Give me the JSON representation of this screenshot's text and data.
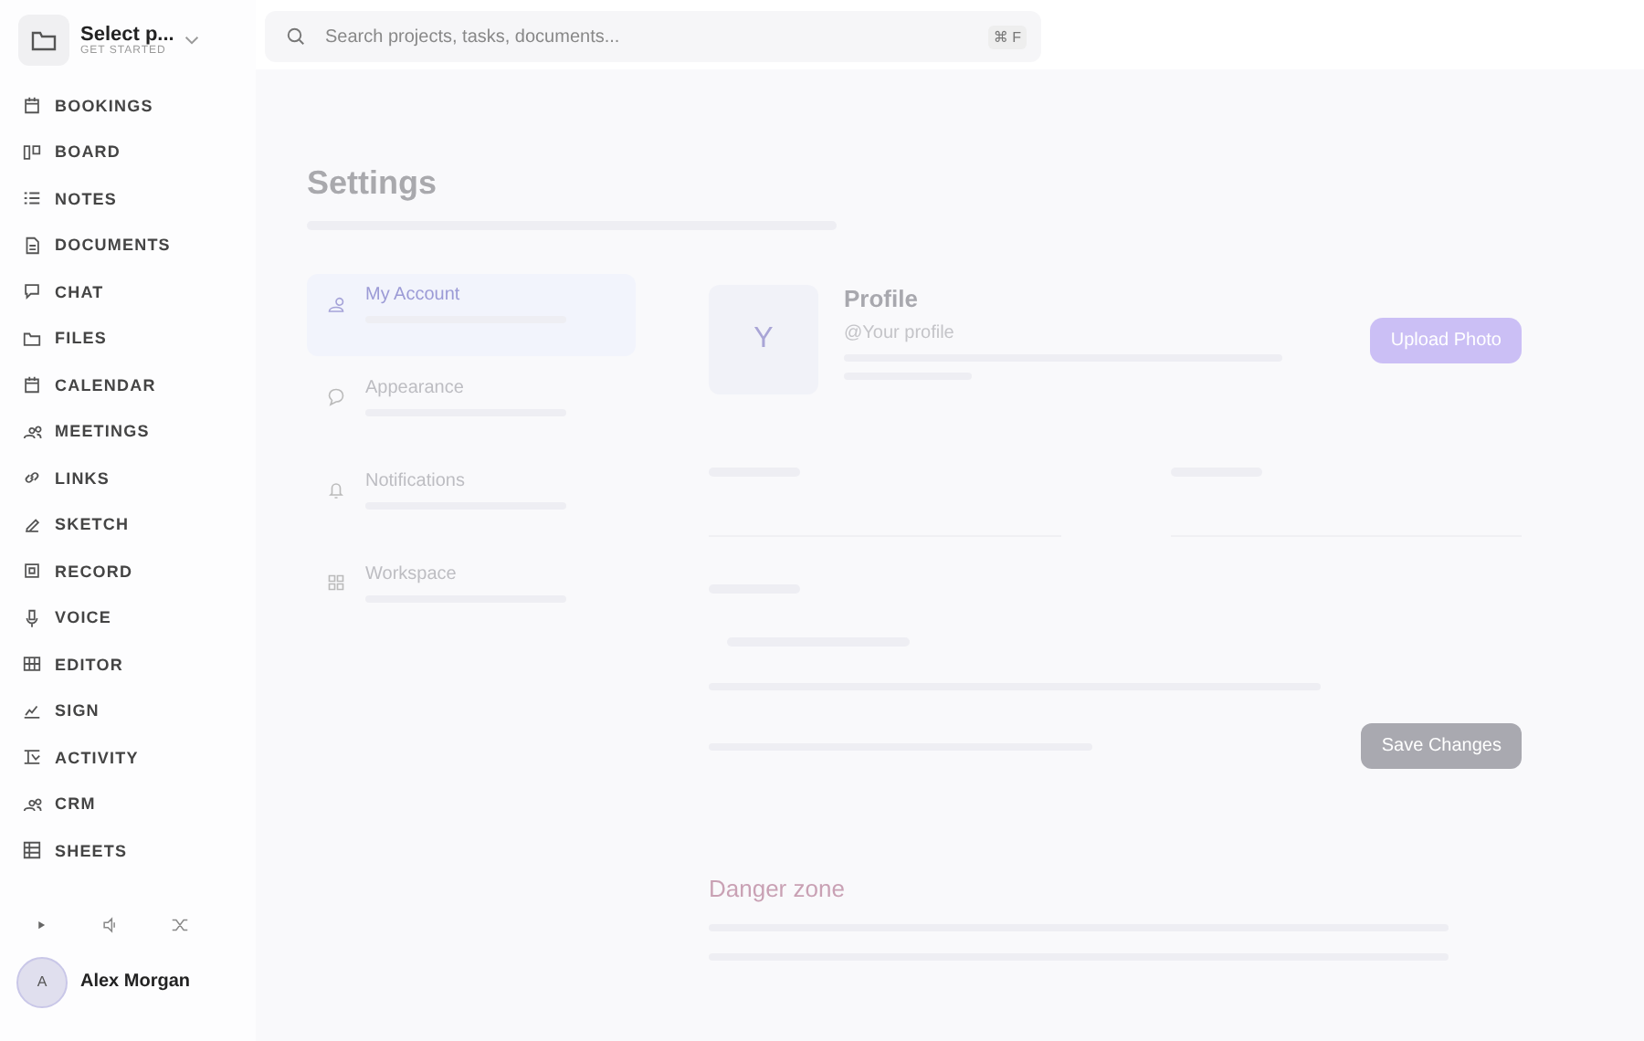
{
  "project_switcher": {
    "title": "Select p...",
    "subtitle": "GET STARTED"
  },
  "search": {
    "placeholder": "Search projects, tasks, documents...",
    "shortcut": "⌘ F"
  },
  "sidebar": {
    "items": [
      {
        "label": "BOOKINGS",
        "selected": false
      },
      {
        "label": "BOARD",
        "selected": false
      },
      {
        "label": "NOTES",
        "selected": false
      },
      {
        "label": "DOCUMENTS",
        "selected": false
      },
      {
        "label": "CHAT",
        "selected": false
      },
      {
        "label": "FILES",
        "selected": false
      },
      {
        "label": "CALENDAR",
        "selected": false
      },
      {
        "label": "MEETINGS",
        "selected": false
      },
      {
        "label": "LINKS",
        "selected": false
      },
      {
        "label": "SKETCH",
        "selected": false
      },
      {
        "label": "RECORD",
        "selected": false
      },
      {
        "label": "VOICE",
        "selected": false
      },
      {
        "label": "EDITOR",
        "selected": false
      },
      {
        "label": "SIGN",
        "selected": false
      },
      {
        "label": "ACTIVITY",
        "selected": false
      },
      {
        "label": "CRM",
        "selected": false
      },
      {
        "label": "SHEETS",
        "selected": false
      }
    ]
  },
  "user": {
    "initial": "A",
    "name": "Alex Morgan"
  },
  "settings": {
    "title": "Settings",
    "nav": [
      {
        "label": "My Account",
        "selected": true
      },
      {
        "label": "Appearance",
        "selected": false
      },
      {
        "label": "Notifications",
        "selected": false
      },
      {
        "label": "Workspace",
        "selected": false
      }
    ],
    "profile": {
      "avatar_initial": "Y",
      "title": "Profile",
      "handle": "@Your profile",
      "upload_button": "Upload Photo",
      "save_button": "Save Changes"
    },
    "danger_zone": {
      "title": "Danger zone"
    }
  }
}
